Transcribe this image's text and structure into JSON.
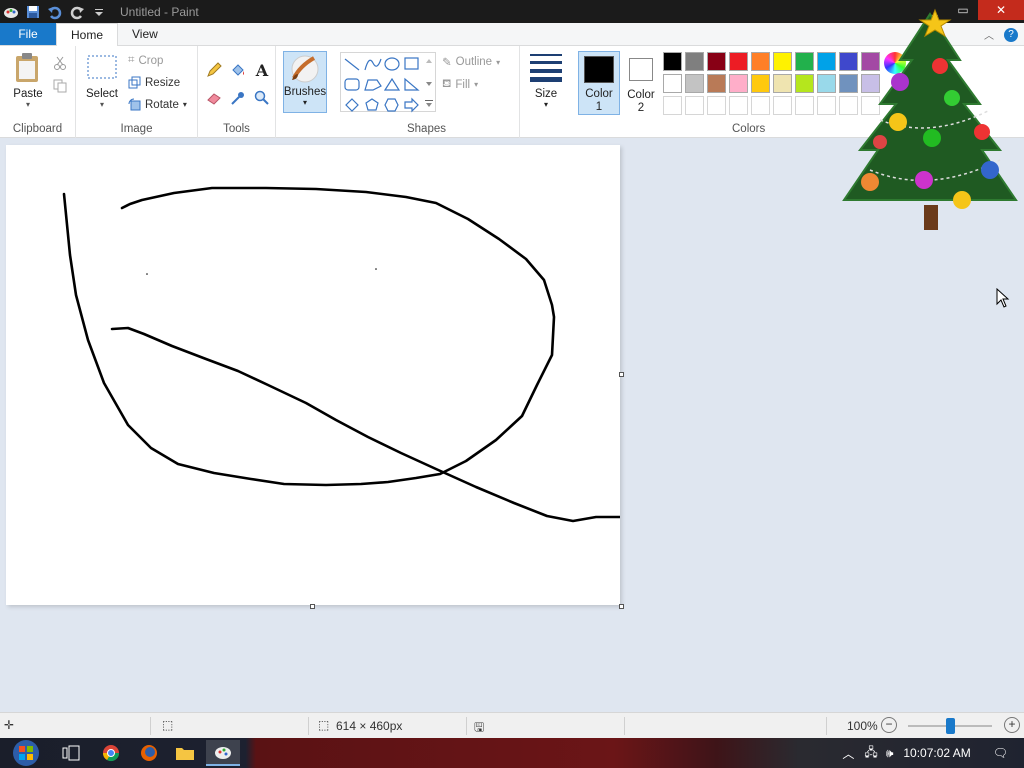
{
  "window": {
    "title": "Untitled - Paint"
  },
  "tabs": {
    "file": "File",
    "home": "Home",
    "view": "View"
  },
  "clipboard": {
    "paste": "Paste",
    "group": "Clipboard"
  },
  "image": {
    "select": "Select",
    "crop": "Crop",
    "resize": "Resize",
    "rotate": "Rotate",
    "group": "Image"
  },
  "tools": {
    "group": "Tools"
  },
  "brushes": {
    "label": "Brushes"
  },
  "shapes": {
    "outline": "Outline",
    "fill": "Fill",
    "group": "Shapes"
  },
  "size": {
    "label": "Size"
  },
  "colors": {
    "color1_line1": "Color",
    "color1_line2": "1",
    "color2_line1": "Color",
    "color2_line2": "2",
    "group": "Colors",
    "color1": "#000000",
    "color2": "#ffffff",
    "row1": [
      "#000000",
      "#7f7f7f",
      "#880015",
      "#ed1c24",
      "#ff7f27",
      "#fff200",
      "#22b14c",
      "#00a2e8",
      "#3f48cc",
      "#a349a4"
    ],
    "row2": [
      "#ffffff",
      "#c3c3c3",
      "#b97a57",
      "#ffaec9",
      "#ffc90e",
      "#efe4b0",
      "#b5e61d",
      "#99d9ea",
      "#7092be",
      "#c8bfe7"
    ]
  },
  "status": {
    "dimensions": "614 × 460px",
    "zoom": "100%"
  },
  "taskbar": {
    "clock": "10:07:02 AM"
  }
}
